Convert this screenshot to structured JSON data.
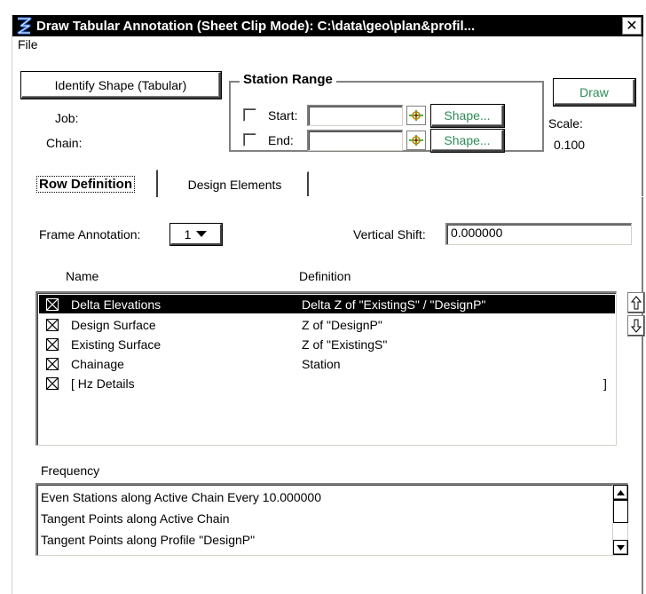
{
  "window": {
    "title": "Draw Tabular Annotation (Sheet Clip Mode): C:\\data\\geo\\plan&profil...",
    "close_glyph": "✕"
  },
  "menu": {
    "file": "File"
  },
  "top": {
    "identify_shape_label": "Identify Shape (Tabular)",
    "job_label": "Job:",
    "chain_label": "Chain:",
    "draw_label": "Draw",
    "scale_label": "Scale:",
    "scale_value": "0.100"
  },
  "station_range": {
    "title": "Station Range",
    "start_label": "Start:",
    "start_value": "",
    "end_label": "End:",
    "end_value": "",
    "shape_label": "Shape...",
    "shape_label_2": "Shape..."
  },
  "tabs": [
    {
      "label": "Row Definition",
      "active": true
    },
    {
      "label": "Design Elements",
      "active": false
    }
  ],
  "row_definition": {
    "frame_annotation_label": "Frame Annotation:",
    "frame_annotation_value": "1",
    "vertical_shift_label": "Vertical Shift:",
    "vertical_shift_value": "0.000000",
    "col_name": "Name",
    "col_definition": "Definition",
    "rows": [
      {
        "name": "Delta Elevations",
        "definition": "Delta Z of \"ExistingS\" / \"DesignP\"",
        "checked": true,
        "selected": true
      },
      {
        "name": "Design Surface",
        "definition": "Z of \"DesignP\"",
        "checked": true,
        "selected": false
      },
      {
        "name": "Existing Surface",
        "definition": "Z of \"ExistingS\"",
        "checked": true,
        "selected": false
      },
      {
        "name": "Chainage",
        "definition": "Station",
        "checked": true,
        "selected": false
      },
      {
        "name": "[ Hz Details",
        "definition": "",
        "bracket": "]",
        "checked": true,
        "selected": false
      }
    ],
    "frequency_label": "Frequency",
    "frequency_items": [
      "Even Stations along Active Chain  Every  10.000000",
      "Tangent Points along Active Chain",
      "Tangent Points along Profile \"DesignP\""
    ]
  },
  "colors": {
    "accent_green": "#2e8b57",
    "title_bg": "#000000"
  }
}
